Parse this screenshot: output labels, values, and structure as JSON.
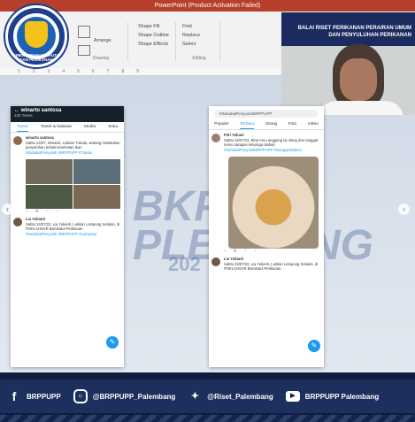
{
  "app": {
    "title": "PowerPoint (Product Activation Failed)"
  },
  "ribbon": {
    "tabs": [
      "Arrange",
      "Quick Styles",
      "Shape Fill",
      "Shape Outline",
      "Shape Effects",
      "Find",
      "Replace",
      "Select"
    ],
    "groups": [
      "Drawing",
      "Editing"
    ]
  },
  "logo": {
    "text": "KEMENTERIAN KELAUTAN DAN PERIKANAN"
  },
  "webcam": {
    "banner": "BALAI RISET PERIKANAN PERAIRAN UMUM DAN PENYULUHAN PERIKANAN"
  },
  "watermark": {
    "line1": "BKP",
    "line2": "PLEBOUNG",
    "year": "202"
  },
  "left_phone": {
    "name": "winarto santosa",
    "count": "226 Tweet",
    "tabs": [
      "Tweet",
      "Tweet & balasan",
      "Media",
      "Suka"
    ],
    "tweet1_handle": "winarto santosa",
    "tweet1_text": "Sabtu 24/07, Winarto, Lukitan Tutudu, sedang melakukan penyuluhan terkait kesehatan ikan",
    "tweet1_tags": "#SahabatPenyuluh #BRPPUPP #Tutudu",
    "tweet2_handle": "Lia Yulianti",
    "tweet2_text": "Sabtu 24/07/22, Lia Yulianti, Lukitan Lampung Selatan, di POKLAHSAR Barokatul Perikanan",
    "tweet2_tags": "#SahabatPenyuluh #BRPPUPP #Lampung"
  },
  "right_phone": {
    "search": "#SahabatPenyuluhBRPPUPP",
    "tabs": [
      "Populer",
      "Terbaru",
      "Orang",
      "Foto",
      "Video"
    ],
    "tweet1_handle": "Fitri Yuliani",
    "tweet1_text": "Sabtu 24/07/22, Bina Amu anggang lai olang dan tanggal menu sarapan ketumga olahan",
    "tweet1_tags": "#SahabatPenyuluhBRPPUPP #Ganguplastikan",
    "tweet2_handle": "Lia Yulianti",
    "tweet2_text": "Sabtu 24/07/22, Lia Yulianti, Lukitan Lampung Selatan, di POKLAHSAR Barokatul Perikanan"
  },
  "social": {
    "facebook": "BRPPUPP",
    "instagram": "@BRPPUPP_Palembang",
    "twitter": "@Riset_Palembang",
    "youtube": "BRPPUPP Palembang"
  }
}
